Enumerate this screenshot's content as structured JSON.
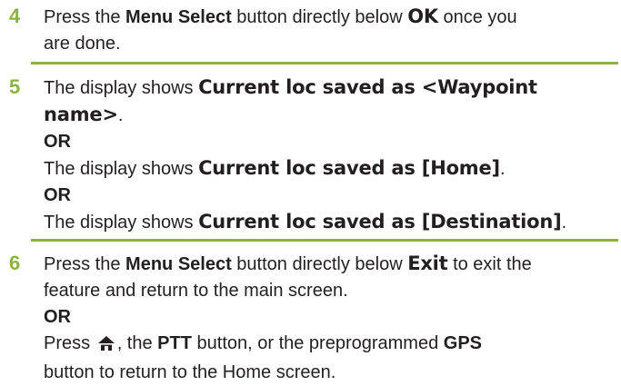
{
  "steps": [
    {
      "number": "4",
      "line1_pre": "Press the ",
      "line1_bold": "Menu Select",
      "line1_mid": " button directly below ",
      "line1_key": "OK",
      "line1_post": " once you",
      "line2": "are done."
    },
    {
      "number": "5",
      "a_pre": "The display shows ",
      "a_msg1": "Current loc saved as <Waypoint",
      "a_msg2": "name>",
      "a_post": ".",
      "or1": "OR",
      "b_pre": "The display shows ",
      "b_msg": "Current loc saved as [Home]",
      "b_post": ".",
      "or2": "OR",
      "c_pre": "The display shows ",
      "c_msg": "Current loc saved as [Destination]",
      "c_post": "."
    },
    {
      "number": "6",
      "a_pre": "Press the ",
      "a_bold": "Menu Select",
      "a_mid": " button directly below ",
      "a_key": "Exit",
      "a_post": " to exit the",
      "a_line2": "feature and return to the main screen.",
      "or": "OR",
      "b_pre": "Press ",
      "b_icon": "home-icon",
      "b_mid1": ", the ",
      "b_ptt": "PTT",
      "b_mid2": " button, or the preprogrammed ",
      "b_gps": "GPS",
      "b_line2": "button to return to the Home screen."
    }
  ],
  "colors": {
    "accent": "#8cb33f",
    "text": "#231f20"
  }
}
